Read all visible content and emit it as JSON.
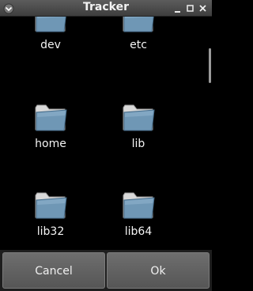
{
  "window": {
    "title": "Tracker"
  },
  "folders": [
    {
      "name": "dev"
    },
    {
      "name": "etc"
    },
    {
      "name": "home"
    },
    {
      "name": "lib"
    },
    {
      "name": "lib32"
    },
    {
      "name": "lib64"
    }
  ],
  "actions": {
    "cancel_label": "Cancel",
    "ok_label": "Ok"
  },
  "icons": {
    "folder": "folder-icon",
    "window_menu": "window-menu-icon",
    "minimize": "minimize-icon",
    "maximize": "maximize-icon",
    "close": "close-icon"
  },
  "colors": {
    "background": "#000000",
    "titlebar": "#4a4a4a",
    "button": "#606060",
    "folder": "#6f97b5"
  }
}
